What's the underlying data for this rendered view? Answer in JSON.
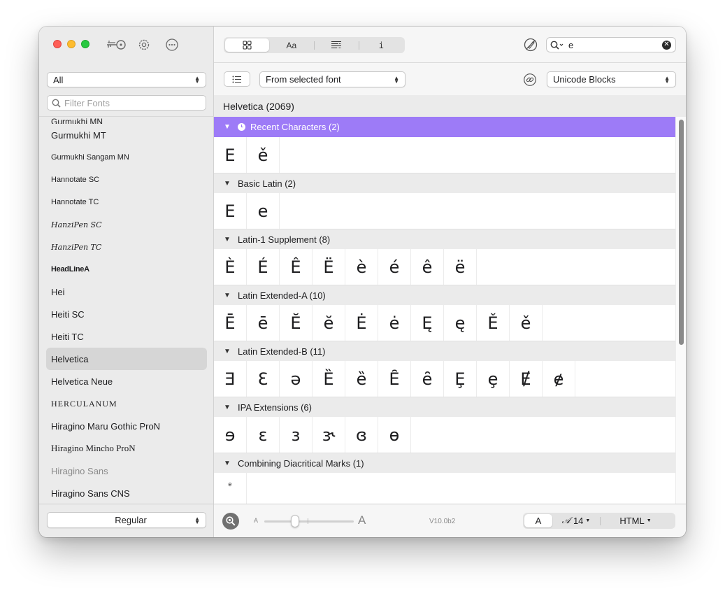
{
  "sidebar": {
    "collection": "All",
    "filter_placeholder": "Filter Fonts",
    "fonts": [
      {
        "name": "Gurmukhi MN",
        "style": "partial"
      },
      {
        "name": "Gurmukhi MT",
        "style": ""
      },
      {
        "name": "Gurmukhi Sangam MN",
        "style": "small"
      },
      {
        "name": "Hannotate SC",
        "style": "small"
      },
      {
        "name": "Hannotate TC",
        "style": "small"
      },
      {
        "name": "HanziPen SC",
        "style": "hand"
      },
      {
        "name": "HanziPen TC",
        "style": "hand"
      },
      {
        "name": "HeadLineA",
        "style": "bold"
      },
      {
        "name": "Hei",
        "style": ""
      },
      {
        "name": "Heiti SC",
        "style": ""
      },
      {
        "name": "Heiti TC",
        "style": ""
      },
      {
        "name": "Helvetica",
        "style": "selected"
      },
      {
        "name": "Helvetica Neue",
        "style": ""
      },
      {
        "name": "HERCULANUM",
        "style": "caps"
      },
      {
        "name": "Hiragino Maru Gothic ProN",
        "style": ""
      },
      {
        "name": "Hiragino Mincho ProN",
        "style": "serif"
      },
      {
        "name": "Hiragino Sans",
        "style": "light"
      },
      {
        "name": "Hiragino Sans CNS",
        "style": ""
      }
    ],
    "style_popup": "Regular"
  },
  "toolbar": {
    "segments": [
      "grid",
      "Aa",
      "list-detail",
      "i"
    ],
    "search_query": "e",
    "source_popup": "From selected font",
    "group_popup": "Unicode Blocks"
  },
  "font_header": "Helvetica (2069)",
  "sections": [
    {
      "title": "Recent Characters (2)",
      "highlight": true,
      "glyphs": [
        "E",
        "ě"
      ]
    },
    {
      "title": "Basic Latin (2)",
      "highlight": false,
      "glyphs": [
        "E",
        "e"
      ]
    },
    {
      "title": "Latin-1 Supplement (8)",
      "highlight": false,
      "glyphs": [
        "È",
        "É",
        "Ê",
        "Ë",
        "è",
        "é",
        "ê",
        "ë"
      ]
    },
    {
      "title": "Latin Extended-A (10)",
      "highlight": false,
      "glyphs": [
        "Ē",
        "ē",
        "Ĕ",
        "ĕ",
        "Ė",
        "ė",
        "Ę",
        "ę",
        "Ě",
        "ě"
      ]
    },
    {
      "title": "Latin Extended-B (11)",
      "highlight": false,
      "glyphs": [
        "Ǝ",
        "Ɛ",
        "ǝ",
        "Ȅ",
        "ȅ",
        "Ȇ",
        "ȇ",
        "Ȩ",
        "ȩ",
        "Ɇ",
        "ɇ"
      ]
    },
    {
      "title": "IPA Extensions (6)",
      "highlight": false,
      "glyphs": [
        "ɘ",
        "ɛ",
        "ɜ",
        "ɝ",
        "ɞ",
        "ɵ"
      ]
    },
    {
      "title": "Combining Diacritical Marks (1)",
      "highlight": false,
      "glyphs": [
        "ͤ"
      ],
      "small": true
    }
  ],
  "footer": {
    "size_small_label": "A",
    "size_large_label": "A",
    "slider_value": 0.33,
    "version": "V10.0b2",
    "format_a": "A",
    "format_script": "𝒜",
    "font_size": "14",
    "output_format": "HTML"
  },
  "colors": {
    "highlight": "#9d7bf7",
    "close": "#fe5f57",
    "minimize": "#febc2e",
    "maximize": "#28c840"
  }
}
